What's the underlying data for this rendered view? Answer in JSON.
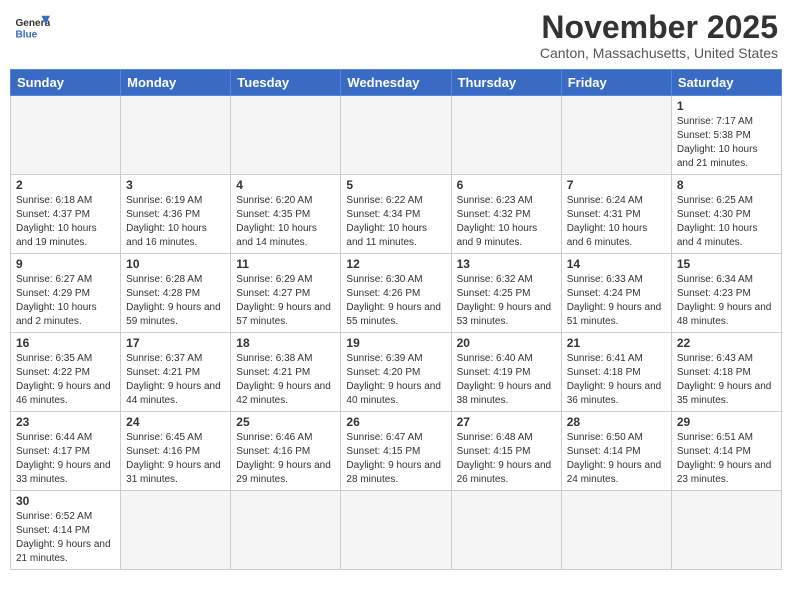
{
  "header": {
    "logo_line1": "General",
    "logo_line2": "Blue",
    "month_year": "November 2025",
    "location": "Canton, Massachusetts, United States"
  },
  "days_of_week": [
    "Sunday",
    "Monday",
    "Tuesday",
    "Wednesday",
    "Thursday",
    "Friday",
    "Saturday"
  ],
  "weeks": [
    [
      {
        "day": "",
        "info": ""
      },
      {
        "day": "",
        "info": ""
      },
      {
        "day": "",
        "info": ""
      },
      {
        "day": "",
        "info": ""
      },
      {
        "day": "",
        "info": ""
      },
      {
        "day": "",
        "info": ""
      },
      {
        "day": "1",
        "info": "Sunrise: 7:17 AM\nSunset: 5:38 PM\nDaylight: 10 hours and 21 minutes."
      }
    ],
    [
      {
        "day": "2",
        "info": "Sunrise: 6:18 AM\nSunset: 4:37 PM\nDaylight: 10 hours and 19 minutes."
      },
      {
        "day": "3",
        "info": "Sunrise: 6:19 AM\nSunset: 4:36 PM\nDaylight: 10 hours and 16 minutes."
      },
      {
        "day": "4",
        "info": "Sunrise: 6:20 AM\nSunset: 4:35 PM\nDaylight: 10 hours and 14 minutes."
      },
      {
        "day": "5",
        "info": "Sunrise: 6:22 AM\nSunset: 4:34 PM\nDaylight: 10 hours and 11 minutes."
      },
      {
        "day": "6",
        "info": "Sunrise: 6:23 AM\nSunset: 4:32 PM\nDaylight: 10 hours and 9 minutes."
      },
      {
        "day": "7",
        "info": "Sunrise: 6:24 AM\nSunset: 4:31 PM\nDaylight: 10 hours and 6 minutes."
      },
      {
        "day": "8",
        "info": "Sunrise: 6:25 AM\nSunset: 4:30 PM\nDaylight: 10 hours and 4 minutes."
      }
    ],
    [
      {
        "day": "9",
        "info": "Sunrise: 6:27 AM\nSunset: 4:29 PM\nDaylight: 10 hours and 2 minutes."
      },
      {
        "day": "10",
        "info": "Sunrise: 6:28 AM\nSunset: 4:28 PM\nDaylight: 9 hours and 59 minutes."
      },
      {
        "day": "11",
        "info": "Sunrise: 6:29 AM\nSunset: 4:27 PM\nDaylight: 9 hours and 57 minutes."
      },
      {
        "day": "12",
        "info": "Sunrise: 6:30 AM\nSunset: 4:26 PM\nDaylight: 9 hours and 55 minutes."
      },
      {
        "day": "13",
        "info": "Sunrise: 6:32 AM\nSunset: 4:25 PM\nDaylight: 9 hours and 53 minutes."
      },
      {
        "day": "14",
        "info": "Sunrise: 6:33 AM\nSunset: 4:24 PM\nDaylight: 9 hours and 51 minutes."
      },
      {
        "day": "15",
        "info": "Sunrise: 6:34 AM\nSunset: 4:23 PM\nDaylight: 9 hours and 48 minutes."
      }
    ],
    [
      {
        "day": "16",
        "info": "Sunrise: 6:35 AM\nSunset: 4:22 PM\nDaylight: 9 hours and 46 minutes."
      },
      {
        "day": "17",
        "info": "Sunrise: 6:37 AM\nSunset: 4:21 PM\nDaylight: 9 hours and 44 minutes."
      },
      {
        "day": "18",
        "info": "Sunrise: 6:38 AM\nSunset: 4:21 PM\nDaylight: 9 hours and 42 minutes."
      },
      {
        "day": "19",
        "info": "Sunrise: 6:39 AM\nSunset: 4:20 PM\nDaylight: 9 hours and 40 minutes."
      },
      {
        "day": "20",
        "info": "Sunrise: 6:40 AM\nSunset: 4:19 PM\nDaylight: 9 hours and 38 minutes."
      },
      {
        "day": "21",
        "info": "Sunrise: 6:41 AM\nSunset: 4:18 PM\nDaylight: 9 hours and 36 minutes."
      },
      {
        "day": "22",
        "info": "Sunrise: 6:43 AM\nSunset: 4:18 PM\nDaylight: 9 hours and 35 minutes."
      }
    ],
    [
      {
        "day": "23",
        "info": "Sunrise: 6:44 AM\nSunset: 4:17 PM\nDaylight: 9 hours and 33 minutes."
      },
      {
        "day": "24",
        "info": "Sunrise: 6:45 AM\nSunset: 4:16 PM\nDaylight: 9 hours and 31 minutes."
      },
      {
        "day": "25",
        "info": "Sunrise: 6:46 AM\nSunset: 4:16 PM\nDaylight: 9 hours and 29 minutes."
      },
      {
        "day": "26",
        "info": "Sunrise: 6:47 AM\nSunset: 4:15 PM\nDaylight: 9 hours and 28 minutes."
      },
      {
        "day": "27",
        "info": "Sunrise: 6:48 AM\nSunset: 4:15 PM\nDaylight: 9 hours and 26 minutes."
      },
      {
        "day": "28",
        "info": "Sunrise: 6:50 AM\nSunset: 4:14 PM\nDaylight: 9 hours and 24 minutes."
      },
      {
        "day": "29",
        "info": "Sunrise: 6:51 AM\nSunset: 4:14 PM\nDaylight: 9 hours and 23 minutes."
      }
    ],
    [
      {
        "day": "30",
        "info": "Sunrise: 6:52 AM\nSunset: 4:14 PM\nDaylight: 9 hours and 21 minutes."
      },
      {
        "day": "",
        "info": ""
      },
      {
        "day": "",
        "info": ""
      },
      {
        "day": "",
        "info": ""
      },
      {
        "day": "",
        "info": ""
      },
      {
        "day": "",
        "info": ""
      },
      {
        "day": "",
        "info": ""
      }
    ]
  ]
}
